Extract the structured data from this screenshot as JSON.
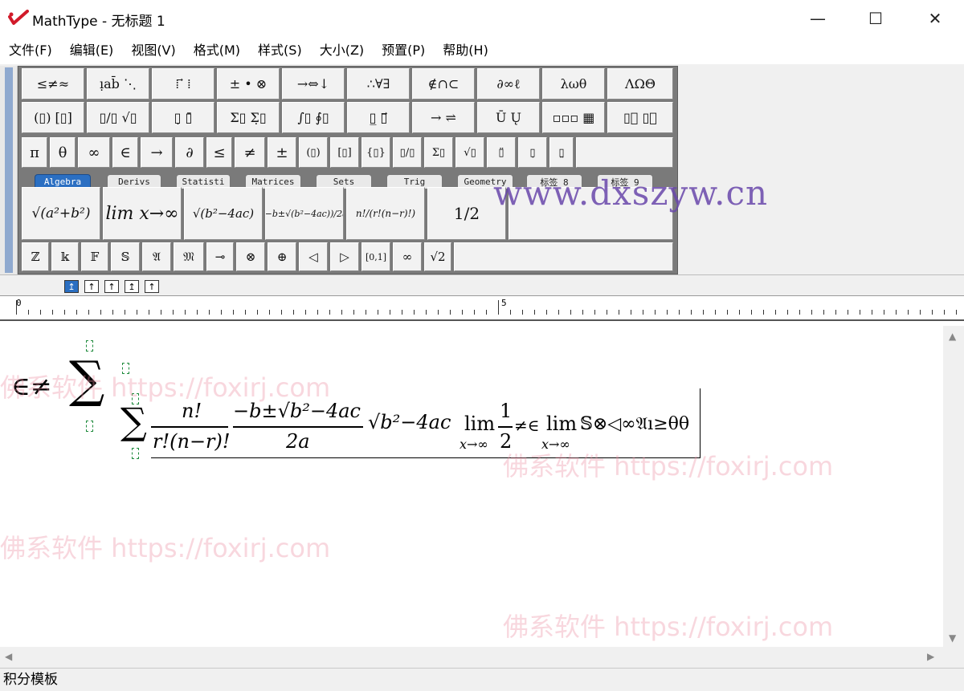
{
  "window": {
    "title": "MathType - 无标题 1",
    "min_glyph": "—",
    "max_glyph": "☐",
    "close_glyph": "✕"
  },
  "menu": [
    "文件(F)",
    "编辑(E)",
    "视图(V)",
    "格式(M)",
    "样式(S)",
    "大小(Z)",
    "预置(P)",
    "帮助(H)"
  ],
  "palette": {
    "row1": [
      "≤≠≈",
      "ı̣ab̄ ⋱",
      "⁞ ⃗ ⁞",
      "± • ⊗",
      "→⇔↓",
      "∴∀∃",
      "∉∩⊂",
      "∂∞ℓ",
      "λωθ",
      "ΛΩΘ"
    ],
    "row2": [
      "(▯) [▯]",
      "▯/▯ √▯",
      "▯̣ ▯̄",
      "Σ▯ Σ̣▯",
      "∫▯ ∮▯",
      "▯̲ ▯⃗",
      "→ ⇌",
      "Ū Ų",
      "▫▫▫ ▦",
      "▯⃞ ▯⃞"
    ],
    "row3": [
      "π",
      "θ",
      "∞",
      "∈",
      "→",
      "∂",
      "≤",
      "≠",
      "±",
      "(▯)",
      "[▯]",
      "{▯}",
      "▯/▯",
      "Σ▯",
      "√▯",
      "▯̈",
      "▯̣",
      "▯̤"
    ],
    "tabs": [
      "Algebra",
      "Derivs",
      "Statisti",
      "Matrices",
      "Sets",
      "Trig",
      "Geometry",
      "标签 8",
      "标签 9"
    ],
    "templates": [
      "√(a²+b²)",
      "lim x→∞",
      "√(b²−4ac)",
      "(−b±√(b²−4ac))/2a",
      "n!/(r!(n−r)!)",
      "1/2"
    ],
    "row5": [
      "ℤ",
      "𝕜",
      "𝔽",
      "𝕊",
      "𝔄",
      "𝔐",
      "⊸",
      "⊗",
      "⊕",
      "◁",
      "▷",
      "[0,1]",
      "∞",
      "√2"
    ]
  },
  "ruler": {
    "label_0": "0",
    "label_5": "5"
  },
  "status": "积分模板",
  "equation": {
    "prefix": "∈≠",
    "big_sigma": "∑",
    "small_sigma": "∑",
    "n_fact": "n!",
    "r_fact": "r!(n−r)!",
    "quad_num": "−b±√b²−4ac",
    "quad_den": "2a",
    "sqrt_expr": "√b²−4ac",
    "lim1": "lim",
    "lim1_sub": "x→∞",
    "half_num": "1",
    "half_den": "2",
    "mid": "≠∈",
    "lim2": "lim",
    "lim2_sub": "x→∞",
    "tail": "𝕊⊗◁∞𝔄ı≥θθ"
  },
  "watermarks": {
    "site": "www.dxszyw.cn",
    "fox": "佛系软件 https://foxirj.com"
  }
}
